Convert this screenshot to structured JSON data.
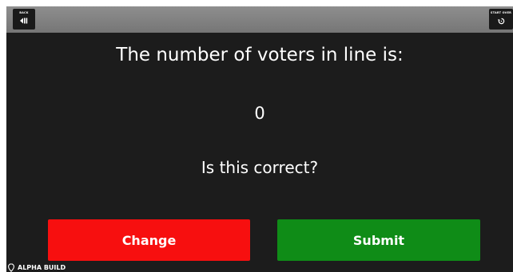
{
  "topbar": {
    "back_label": "BACK",
    "back_icon": "back-arrow-icon",
    "start_over_label": "START OVER",
    "start_over_icon": "restart-icon"
  },
  "main": {
    "question": "The number of voters in line is:",
    "voter_count": "0",
    "confirm_question": "Is this correct?"
  },
  "buttons": {
    "change_label": "Change",
    "change_color": "#f70f0f",
    "submit_label": "Submit",
    "submit_color": "#0f8c17"
  },
  "footer": {
    "build_label": "ALPHA BUILD",
    "icon": "location-pin-icon"
  }
}
